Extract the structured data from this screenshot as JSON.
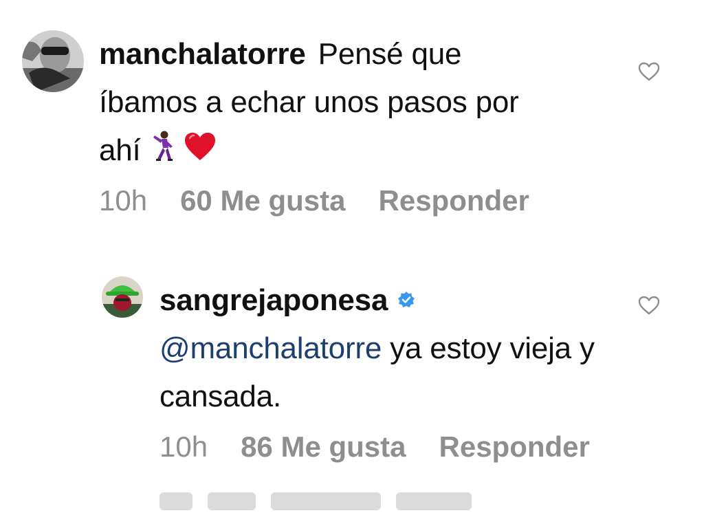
{
  "comments": [
    {
      "username": "manchalatorre",
      "text": "Pensé que íbamos a echar unos pasos por ahí",
      "emojis": [
        "dancing-man-emoji",
        "red-heart-emoji"
      ],
      "time": "10h",
      "likes": "60 Me gusta",
      "reply": "Responder",
      "verified": false
    },
    {
      "username": "sangrejaponesa",
      "mention": "@manchalatorre",
      "text": "ya estoy vieja y cansada.",
      "time": "10h",
      "likes": "86 Me gusta",
      "reply": "Responder",
      "verified": true
    }
  ],
  "colors": {
    "text": "#111111",
    "meta": "#8e8e8e",
    "mention": "#1a3f70",
    "verified_badge": "#3897f0",
    "heart_emoji": "#e0112b"
  }
}
